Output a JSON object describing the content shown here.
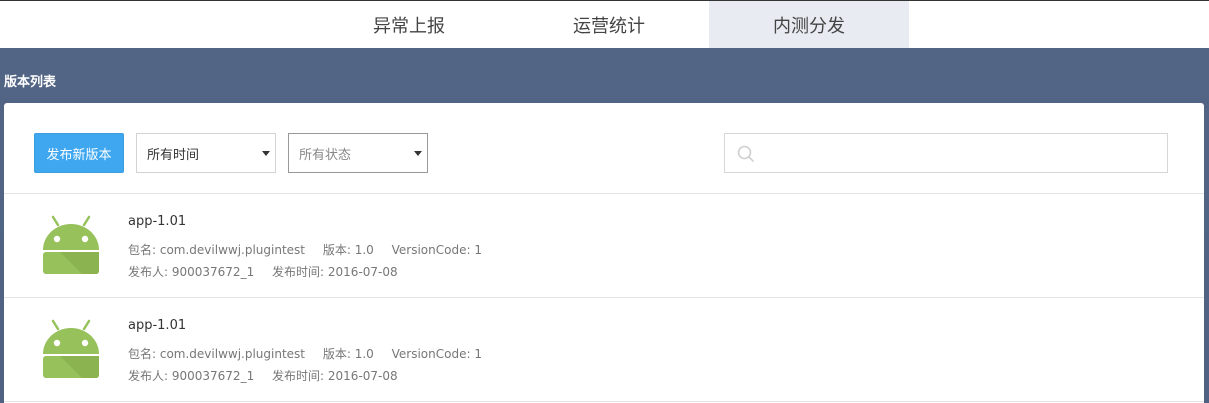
{
  "tabs": [
    {
      "label": "异常上报",
      "active": false
    },
    {
      "label": "运营统计",
      "active": false
    },
    {
      "label": "内测分发",
      "active": true
    }
  ],
  "section_title": "版本列表",
  "toolbar": {
    "publish_label": "发布新版本",
    "time_filter": "所有时间",
    "status_filter": "所有状态",
    "search_icon": "search-icon"
  },
  "versions": [
    {
      "name": "app-1.01",
      "package": "包名: com.devilwwj.plugintest",
      "version": "版本: 1.0",
      "version_code": "VersionCode: 1",
      "publisher": "发布人: 900037672_1",
      "publish_time": "发布时间: 2016-07-08",
      "icon": "android-icon"
    },
    {
      "name": "app-1.01",
      "package": "包名: com.devilwwj.plugintest",
      "version": "版本: 1.0",
      "version_code": "VersionCode: 1",
      "publisher": "发布人: 900037672_1",
      "publish_time": "发布时间: 2016-07-08",
      "icon": "android-icon"
    }
  ],
  "colors": {
    "header_band": "#4f6283",
    "primary_button": "#3ea7ef",
    "android_green": "#97c15a",
    "active_tab": "#e8ecf2"
  }
}
